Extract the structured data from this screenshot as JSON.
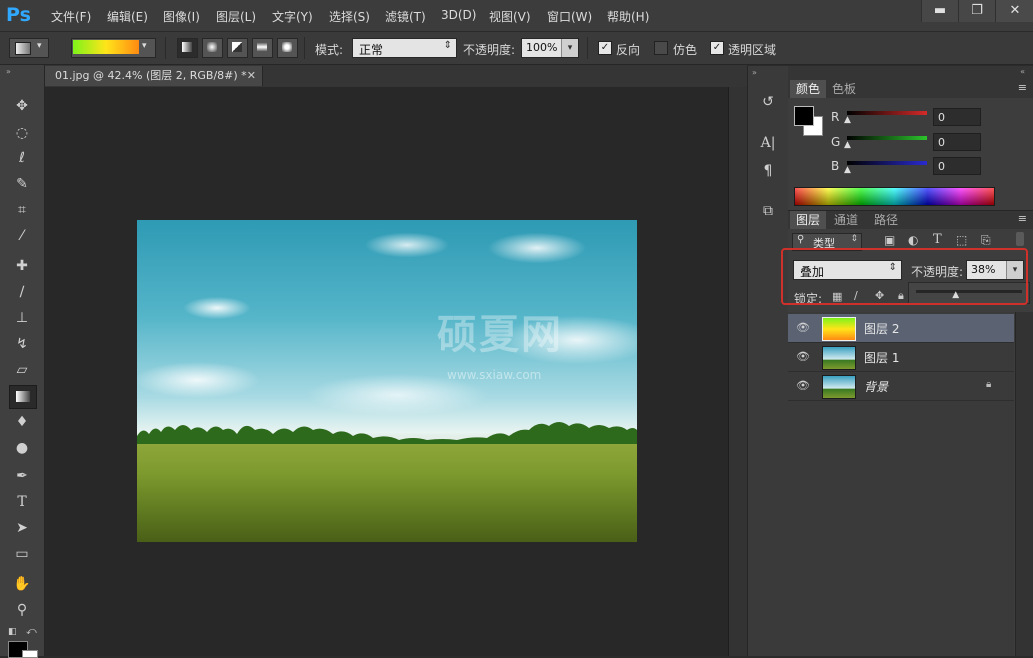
{
  "app": {
    "logo": "Ps"
  },
  "menu": [
    "文件(F)",
    "编辑(E)",
    "图像(I)",
    "图层(L)",
    "文字(Y)",
    "选择(S)",
    "滤镜(T)",
    "3D(D)",
    "视图(V)",
    "窗口(W)",
    "帮助(H)"
  ],
  "window_controls": {
    "minimize": "▬",
    "maximize": "❐",
    "close": "✕"
  },
  "options_bar": {
    "mode_label": "模式:",
    "mode_value": "正常",
    "opacity_label": "不透明度:",
    "opacity_value": "100%",
    "reverse_label": "反向",
    "reverse_checked": true,
    "dither_label": "仿色",
    "dither_checked": false,
    "transparency_label": "透明区域",
    "transparency_checked": true,
    "gradient_colors": [
      "#7ef21a",
      "#ffe51a",
      "#ff8a12"
    ]
  },
  "document": {
    "tab_title": "01.jpg @ 42.4% (图层 2, RGB/8#) *",
    "watermark": "硕夏网",
    "watermark_url": "www.sxiaw.com"
  },
  "color_panel": {
    "tabs": [
      "颜色",
      "色板"
    ],
    "channels": [
      {
        "name": "R",
        "value": "0",
        "color": "#d42a2a"
      },
      {
        "name": "G",
        "value": "0",
        "color": "#2cc42c"
      },
      {
        "name": "B",
        "value": "0",
        "color": "#2a2ad0"
      }
    ]
  },
  "layers_panel": {
    "tabs": [
      "图层",
      "通道",
      "路径"
    ],
    "filter_label": "类型",
    "blend_mode": "叠加",
    "opacity_label": "不透明度:",
    "opacity_value": "38%",
    "opacity_fraction": 0.38,
    "lock_label": "锁定:",
    "layers": [
      {
        "name": "图层 2",
        "selected": true,
        "thumb": "gradient",
        "locked": false
      },
      {
        "name": "图层 1",
        "selected": false,
        "thumb": "photo",
        "locked": false
      },
      {
        "name": "背景",
        "selected": false,
        "thumb": "photo",
        "locked": true
      }
    ]
  },
  "accent": {
    "highlight_border": "#d0302a",
    "ps_blue": "#31a8ff",
    "selected_layer": "#5b6373"
  }
}
